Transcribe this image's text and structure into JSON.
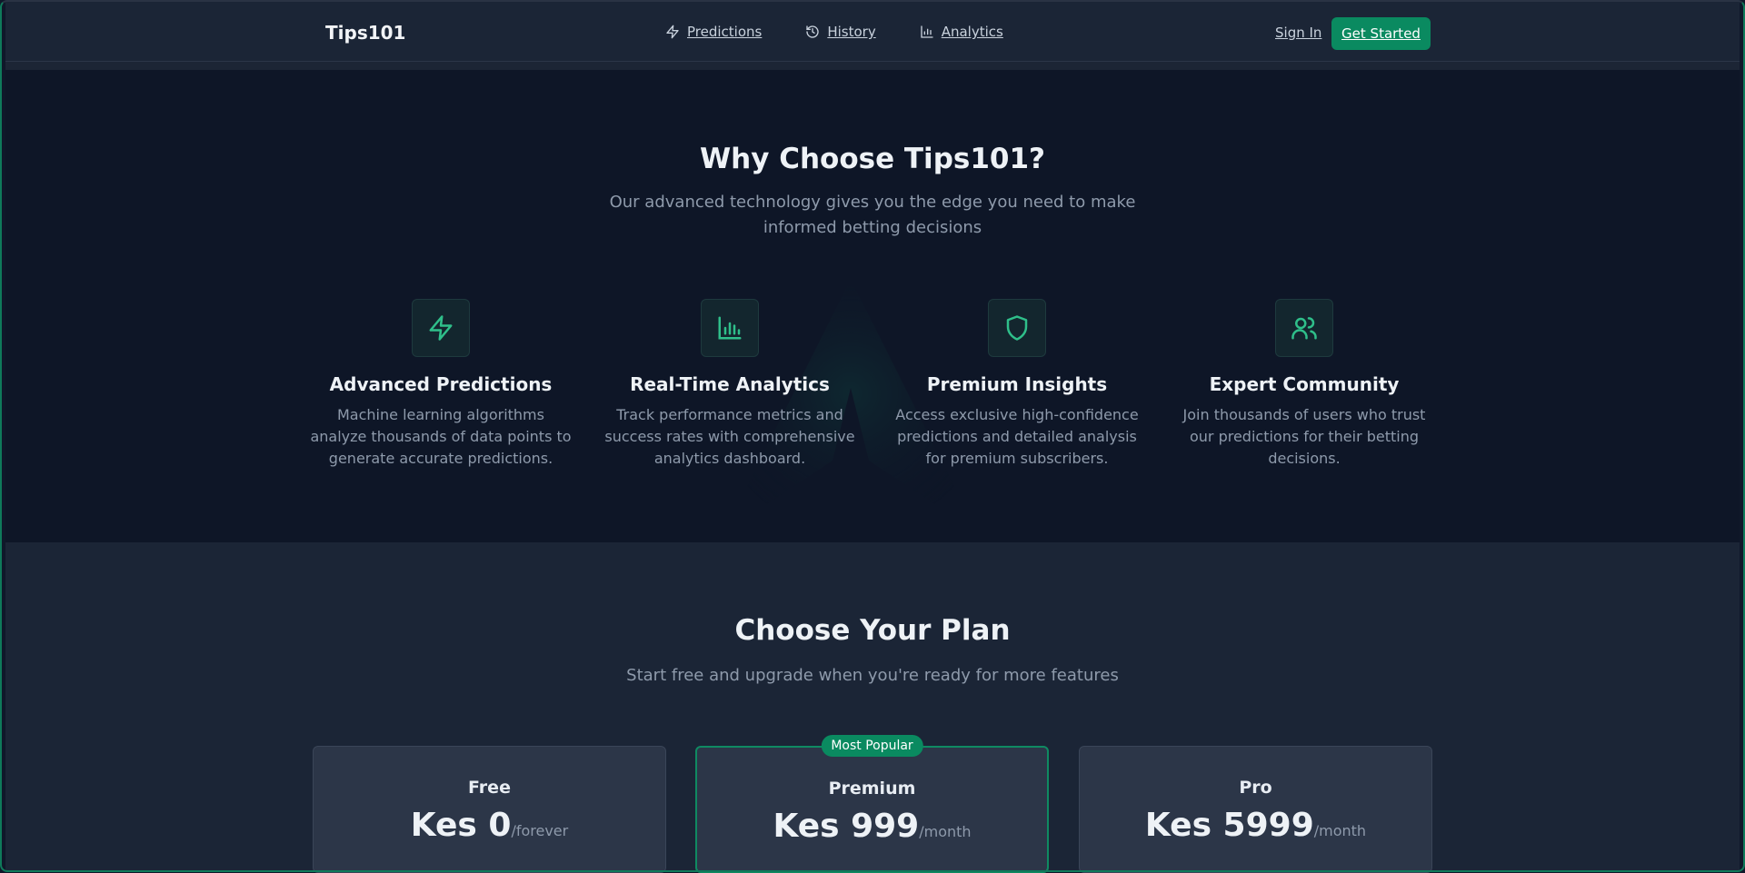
{
  "header": {
    "brand": "Tips101",
    "nav": [
      {
        "label": "Predictions",
        "icon": "zap-icon"
      },
      {
        "label": "History",
        "icon": "history-icon"
      },
      {
        "label": "Analytics",
        "icon": "bar-chart-icon"
      }
    ],
    "sign_in": "Sign In",
    "get_started": "Get Started"
  },
  "features": {
    "title": "Why Choose Tips101?",
    "subtitle": "Our advanced technology gives you the edge you need to make informed betting decisions",
    "items": [
      {
        "icon": "zap-icon",
        "title": "Advanced Predictions",
        "description": "Machine learning algorithms analyze thousands of data points to generate accurate predictions."
      },
      {
        "icon": "bar-chart-icon",
        "title": "Real-Time Analytics",
        "description": "Track performance metrics and success rates with comprehensive analytics dashboard."
      },
      {
        "icon": "shield-icon",
        "title": "Premium Insights",
        "description": "Access exclusive high-confidence predictions and detailed analysis for premium subscribers."
      },
      {
        "icon": "users-icon",
        "title": "Expert Community",
        "description": "Join thousands of users who trust our predictions for their betting decisions."
      }
    ]
  },
  "plans": {
    "title": "Choose Your Plan",
    "subtitle": "Start free and upgrade when you're ready for more features",
    "items": [
      {
        "name": "Free",
        "price": "Kes 0",
        "period": "/forever"
      },
      {
        "name": "Premium",
        "price": "Kes 999",
        "period": "/month",
        "badge": "Most Popular"
      },
      {
        "name": "Pro",
        "price": "Kes 5999",
        "period": "/month"
      }
    ]
  },
  "colors": {
    "accent": "#0a8a60",
    "icon_green": "#2fbf8a",
    "background": "#0e1627",
    "header": "#1b2536"
  }
}
